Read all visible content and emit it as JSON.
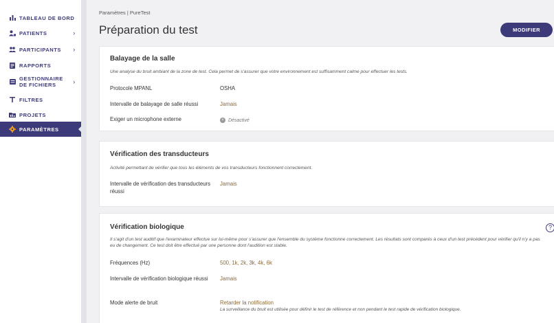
{
  "sidebar": {
    "items": [
      {
        "label": "TABLEAU DE BORD",
        "icon": "bar-chart-icon"
      },
      {
        "label": "PATIENTS",
        "icon": "patient-icon"
      },
      {
        "label": "PARTICIPANTS",
        "icon": "participants-icon"
      },
      {
        "label": "RAPPORTS",
        "icon": "report-icon"
      },
      {
        "label": "GESTIONNAIRE DE FICHIERS",
        "icon": "file-manager-icon"
      },
      {
        "label": "FILTRES",
        "icon": "filter-icon"
      },
      {
        "label": "PROJETS",
        "icon": "folder-icon"
      },
      {
        "label": "PARAMÈTRES",
        "icon": "gear-icon"
      }
    ],
    "chevron": "›"
  },
  "header": {
    "breadcrumb": "Paramètres | PureTest",
    "title": "Préparation du test",
    "modify_label": "MODIFIER"
  },
  "sections": {
    "room": {
      "title": "Balayage de la salle",
      "description": "Une analyse du bruit ambiant de la zone de test. Cela permet de s'assurer que votre environnement est suffisamment calme pour effectuer les tests.",
      "rows": [
        {
          "label": "Protocole MPANL",
          "value": "OSHA"
        },
        {
          "label": "Intervalle de balayage de salle réussi",
          "value": "Jamais"
        },
        {
          "label": "Exiger un microphone externe",
          "value": "Désactivé"
        }
      ]
    },
    "transducers": {
      "title": "Vérification des transducteurs",
      "description": "Activité permettant de vérifier que tous les éléments de vos transducteurs fonctionnent correctement.",
      "rows": [
        {
          "label": "Intervalle de vérification des transducteurs réussi",
          "value": "Jamais"
        }
      ]
    },
    "biological": {
      "title": "Vérification biologique",
      "description": "Il s'agit d'un test auditif que l'examinateur effectue sur lui-même pour s'assurer que l'ensemble du système fonctionne correctement. Les résultats sont comparés à ceux d'un test précédent pour vérifier qu'il n'y a pas eu de changement. Ce test doit être effectué par une personne dont l'audition est stable.",
      "help": "?",
      "rows": [
        {
          "label": "Fréquences (Hz)",
          "value": "500, 1k, 2k, 3k, 4k, 6k"
        },
        {
          "label": "Intervalle de vérification biologique réussi",
          "value": "Jamais"
        },
        {
          "label": "Mode alerte de bruit",
          "value": "Retarder la notification",
          "note": "La surveillance du bruit est utilisée pour définir le test de référence et non pendant le test rapide de vérification biologique."
        }
      ]
    }
  },
  "colors": {
    "brand": "#3d3a7a",
    "value_accent": "#8a6a3a",
    "background": "#f1f1f4"
  }
}
